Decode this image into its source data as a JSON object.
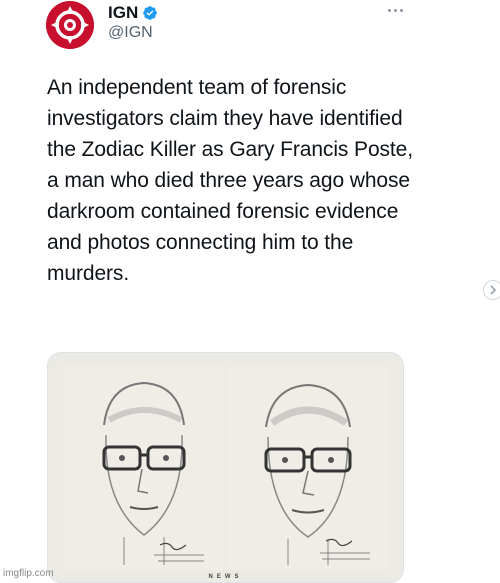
{
  "tweet": {
    "display_name": "IGN",
    "handle": "@IGN",
    "text": "An independent team of forensic investigators claim they have identified the Zodiac Killer as Gary Francis Poste, a man who died three years ago whose darkroom contained forensic evidence and photos connecting him to the murders.",
    "media": {
      "caption": "NEWS"
    }
  },
  "colors": {
    "brand_red": "#c8102e",
    "verified_blue": "#1d9bf0",
    "text": "#0f1419",
    "muted": "#536471"
  },
  "icons": {
    "avatar": "ign-logo",
    "verified": "verified-badge-icon",
    "more": "more-dots-icon",
    "side": "chevron-right-icon"
  },
  "watermark": "imgflip.com"
}
